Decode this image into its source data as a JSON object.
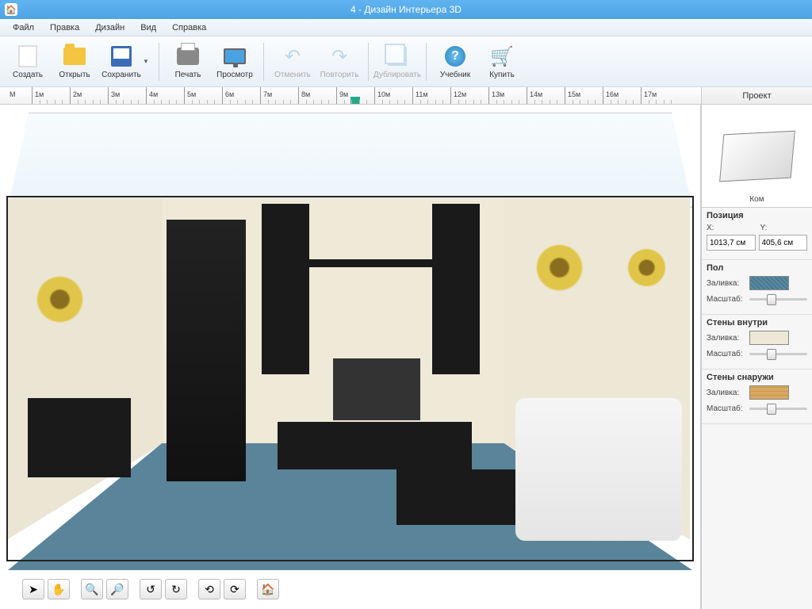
{
  "title": "4 - Дизайн Интерьера 3D",
  "menus": {
    "file": "Файл",
    "edit": "Правка",
    "design": "Дизайн",
    "view": "Вид",
    "help": "Справка"
  },
  "toolbar": {
    "new": "Создать",
    "open": "Открыть",
    "save": "Сохранить",
    "print": "Печать",
    "preview": "Просмотр",
    "undo": "Отменить",
    "redo": "Повторить",
    "duplicate": "Дублировать",
    "tutorial": "Учебник",
    "buy": "Купить"
  },
  "ruler_unit": "М",
  "ruler_ticks": [
    "1м",
    "2м",
    "3м",
    "4м",
    "5м",
    "6м",
    "7м",
    "8м",
    "9м",
    "10м",
    "11м",
    "12м",
    "13м",
    "14м",
    "15м",
    "16м",
    "17м"
  ],
  "side_tab": "Проект",
  "preview_label": "Ком",
  "props": {
    "position_title": "Позиция",
    "x_label": "X:",
    "y_label": "Y:",
    "x_value": "1013,7 см",
    "y_value": "405,6 см",
    "floor_title": "Пол",
    "walls_in_title": "Стены внутри",
    "walls_out_title": "Стены снаружи",
    "fill_label": "Заливка:",
    "scale_label": "Масштаб:"
  }
}
